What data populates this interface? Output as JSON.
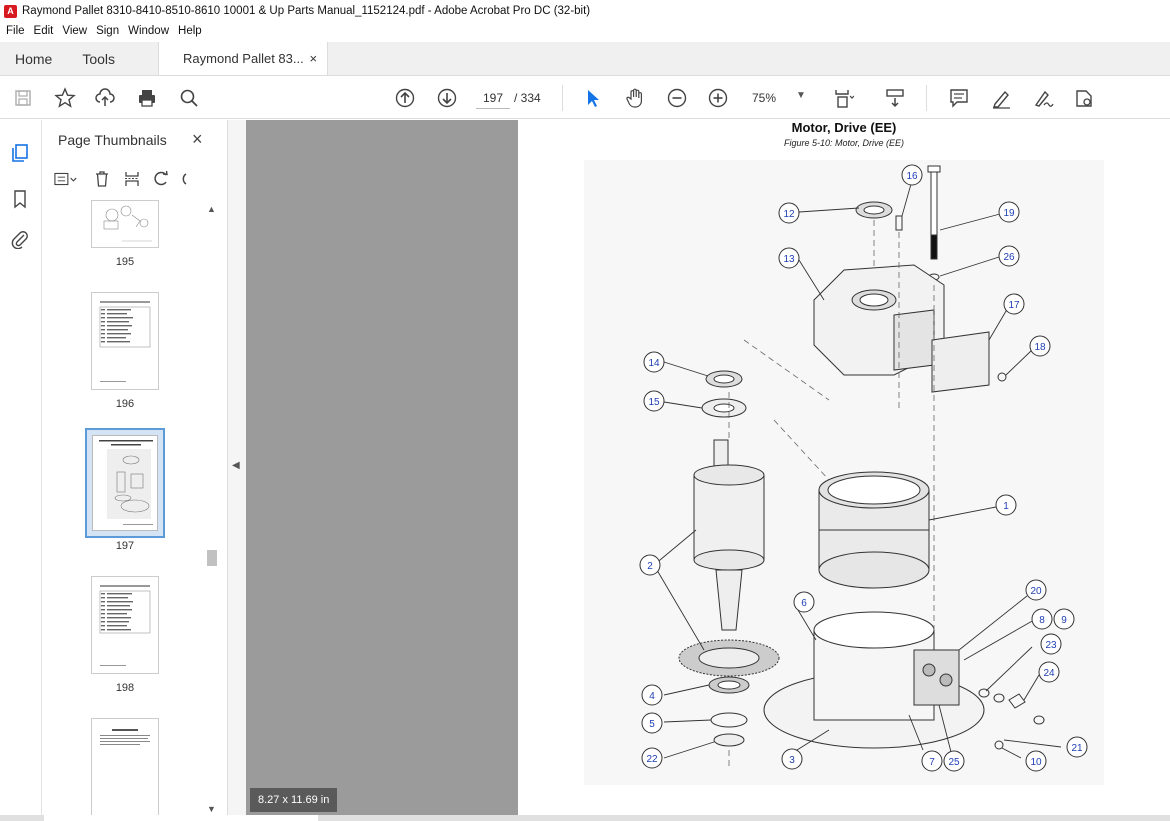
{
  "window": {
    "title": "Raymond Pallet 8310-8410-8510-8610 10001 & Up Parts Manual_1152124.pdf - Adobe Acrobat Pro DC (32-bit)",
    "app_icon": "acrobat-icon"
  },
  "menu": [
    "File",
    "Edit",
    "View",
    "Sign",
    "Window",
    "Help"
  ],
  "tabs": {
    "home": "Home",
    "tools": "Tools",
    "document": "Raymond Pallet 83...",
    "close": "×"
  },
  "toolbar": {
    "current_page": "197",
    "total_pages": "/ 334",
    "zoom": "75%",
    "icons": [
      "save-icon",
      "star-icon",
      "upload-icon",
      "print-icon",
      "search-icon",
      "page-up-icon",
      "page-down-icon",
      "select-cursor-icon",
      "hand-icon",
      "zoom-out-icon",
      "zoom-in-icon",
      "fit-page-icon",
      "scroll-mode-icon",
      "comment-icon",
      "highlight-icon",
      "sign-icon",
      "protect-icon"
    ]
  },
  "thumbnails_panel": {
    "title": "Page Thumbnails",
    "close": "×",
    "pages": [
      {
        "number": "195",
        "selected": false
      },
      {
        "number": "196",
        "selected": false
      },
      {
        "number": "197",
        "selected": true
      },
      {
        "number": "198",
        "selected": false
      },
      {
        "number": "",
        "selected": false
      }
    ]
  },
  "document": {
    "figure_title": "Motor, Drive (EE)",
    "figure_caption": "Figure 5-10: Motor, Drive (EE)",
    "callouts": [
      "1",
      "2",
      "3",
      "4",
      "5",
      "6",
      "7",
      "8",
      "9",
      "10",
      "12",
      "13",
      "14",
      "15",
      "16",
      "17",
      "18",
      "19",
      "20",
      "21",
      "22",
      "23",
      "24",
      "25",
      "26"
    ],
    "page_size": "8.27 x 11.69 in"
  },
  "colors": {
    "accent": "#1473e6",
    "callout": "#1f3fb5",
    "doc_bg": "#9b9b9b",
    "selected_thumb": "#5c9bd8"
  }
}
